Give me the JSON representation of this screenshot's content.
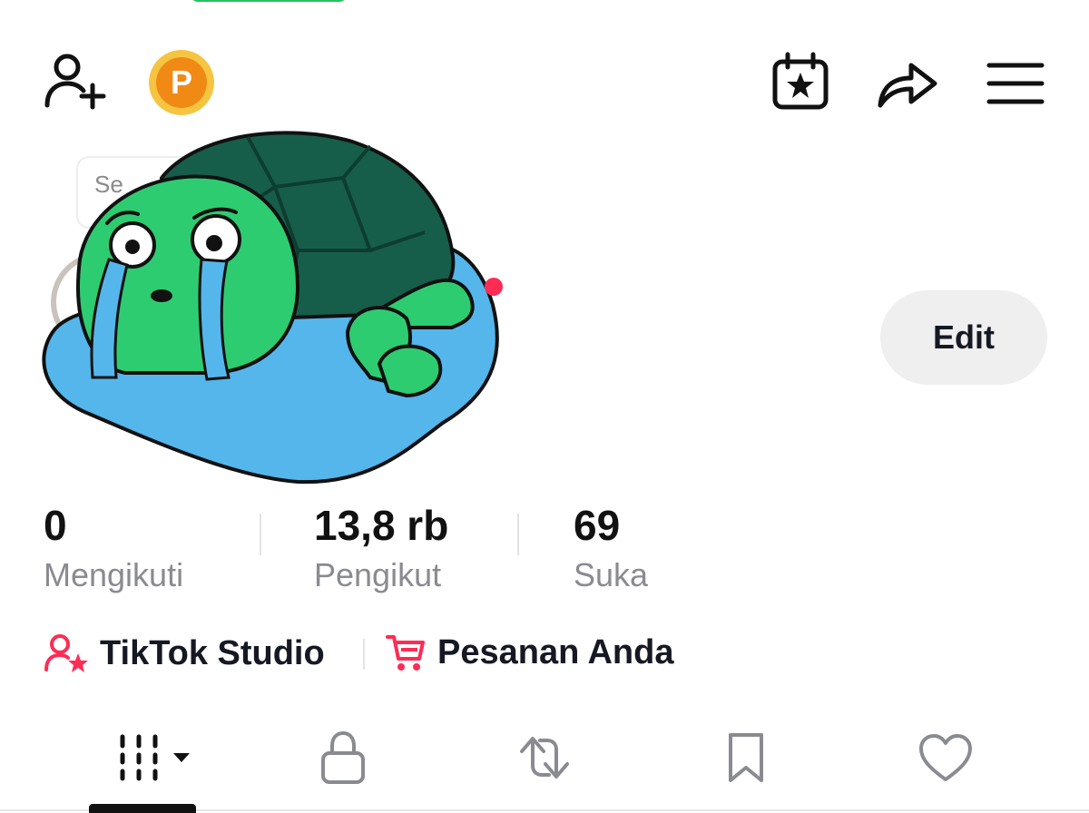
{
  "header": {
    "add_friend_icon": "add-user-icon",
    "points_label": "P",
    "points_colors": {
      "outer": "#f5c542",
      "inner": "#f08a15"
    },
    "events_icon": "calendar-star-icon",
    "share_icon": "share-arrow-icon",
    "menu_icon": "hamburger-menu-icon"
  },
  "profile": {
    "note_text": "Se",
    "edit_label": "Edit"
  },
  "stats": [
    {
      "value": "0",
      "label": "Mengikuti"
    },
    {
      "value": "13,8 rb",
      "label": "Pengikut"
    },
    {
      "value": "69",
      "label": "Suka"
    }
  ],
  "shortcuts": {
    "studio_label": "TikTok Studio",
    "orders_label": "Pesanan Anda"
  },
  "tabs": {
    "items": [
      {
        "icon": "grid-videos-icon"
      },
      {
        "icon": "lock-icon"
      },
      {
        "icon": "repost-icon"
      },
      {
        "icon": "bookmark-icon"
      },
      {
        "icon": "heart-icon"
      }
    ],
    "active_index": 0
  },
  "colors": {
    "accent": "#fe2c55",
    "green_pill": "#22c55e",
    "edit_bg": "#efefef",
    "muted_text": "#8a8b91"
  }
}
